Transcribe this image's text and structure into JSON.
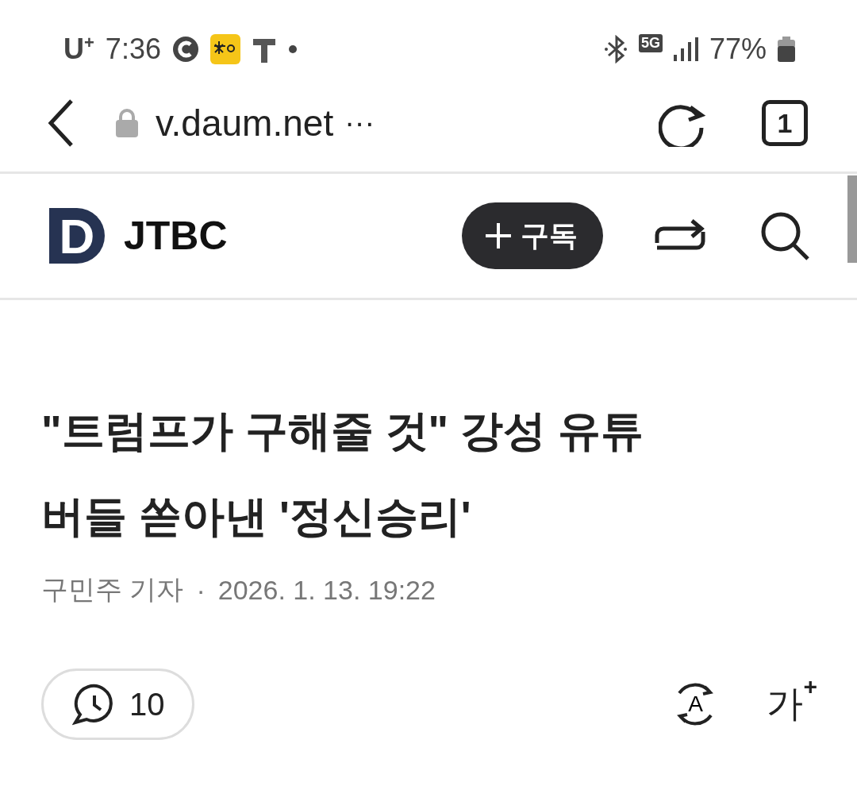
{
  "status_bar": {
    "carrier": "U",
    "carrier_mark": "+",
    "time": "7:36",
    "network": "5G",
    "battery": "77%"
  },
  "address_bar": {
    "url": "v.daum.net",
    "more": "···",
    "tab_count": "1"
  },
  "header": {
    "logo": "D",
    "site": "JTBC",
    "subscribe": "구독"
  },
  "article": {
    "headline_lines": [
      "\"트럼프가 구해줄 것\" 강성 유튜",
      "버들 쏟아낸 '정신승리'"
    ],
    "author": "구민주 기자",
    "separator": "·",
    "date": "2026. 1. 13. 19:22",
    "comments": "10",
    "translate_letter": "A",
    "font_size_label": "가",
    "font_size_mark": "+"
  }
}
